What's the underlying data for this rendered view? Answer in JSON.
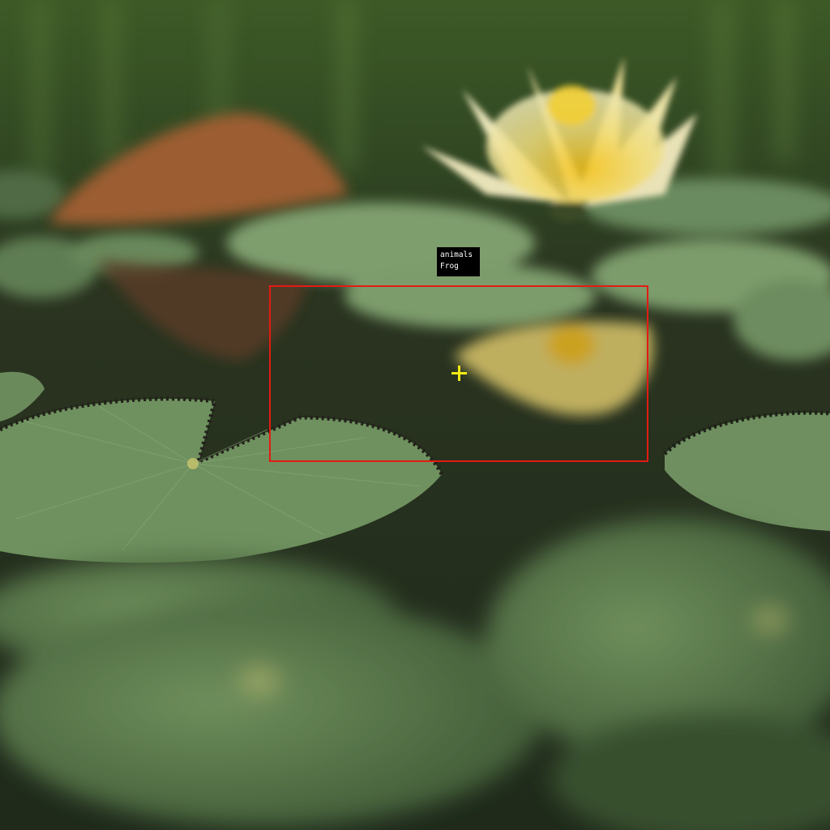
{
  "image": {
    "subject": "lily-pad-pond",
    "annotation": {
      "category": "animals",
      "label": "Frog",
      "box_color": "#e31b12",
      "marker_color": "#f2ea12"
    }
  }
}
